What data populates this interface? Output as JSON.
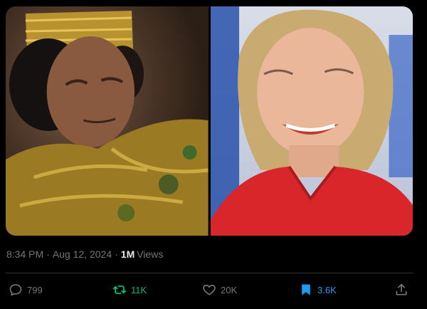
{
  "tweet": {
    "time": "8:34 PM",
    "separator": "·",
    "date": "Aug 12, 2024",
    "views_count": "1M",
    "views_label": "Views"
  },
  "actions": {
    "reply_count": "799",
    "repost_count": "11K",
    "like_count": "20K",
    "bookmark_count": "3.6K"
  },
  "icons": {
    "reply": "reply-icon",
    "repost": "repost-icon",
    "like": "heart-icon",
    "bookmark": "bookmark-icon",
    "share": "share-icon"
  },
  "colors": {
    "background": "#000000",
    "text": "#e7e9ea",
    "muted": "#71767b",
    "repost_active": "#00ba7c",
    "bookmark_active": "#1d9bf0",
    "divider": "#2f3336"
  }
}
